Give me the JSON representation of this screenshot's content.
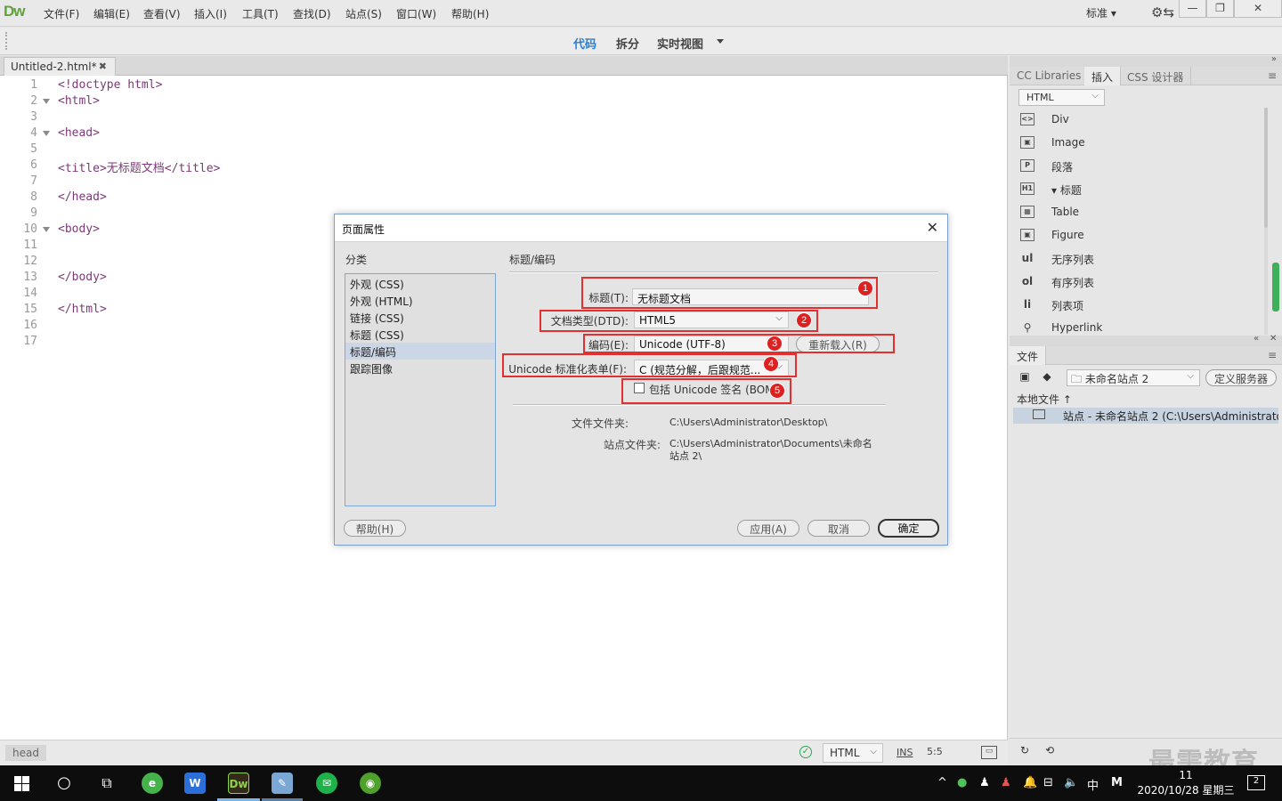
{
  "app": {
    "logo": "Dw",
    "menu": [
      "文件(F)",
      "编辑(E)",
      "查看(V)",
      "插入(I)",
      "工具(T)",
      "查找(D)",
      "站点(S)",
      "窗口(W)",
      "帮助(H)"
    ],
    "workspace": "标准",
    "window_buttons": [
      "—",
      "❐",
      "✕"
    ]
  },
  "toolbar": {
    "code": "代码",
    "split": "拆分",
    "live": "实时视图"
  },
  "doc_tab": {
    "name": "Untitled-2.html*",
    "close": "✖"
  },
  "editor": {
    "lines": [
      {
        "n": "1",
        "code": "<!doctype html>",
        "fold": false
      },
      {
        "n": "2",
        "code": "<html>",
        "fold": true
      },
      {
        "n": "3",
        "code": "",
        "fold": false
      },
      {
        "n": "4",
        "code": "<head>",
        "fold": true
      },
      {
        "n": "5",
        "code": "",
        "fold": false
      },
      {
        "n": "6",
        "code": "<title>无标题文档</title>",
        "fold": false
      },
      {
        "n": "7",
        "code": "",
        "fold": false
      },
      {
        "n": "8",
        "code": "</head>",
        "fold": false
      },
      {
        "n": "9",
        "code": "",
        "fold": false
      },
      {
        "n": "10",
        "code": "<body>",
        "fold": true
      },
      {
        "n": "11",
        "code": "",
        "fold": false
      },
      {
        "n": "12",
        "code": "",
        "fold": false
      },
      {
        "n": "13",
        "code": "</body>",
        "fold": false
      },
      {
        "n": "14",
        "code": "",
        "fold": false
      },
      {
        "n": "15",
        "code": "</html>",
        "fold": false
      },
      {
        "n": "16",
        "code": "",
        "fold": false
      },
      {
        "n": "17",
        "code": "",
        "fold": false
      }
    ]
  },
  "statusbar": {
    "tag": "head",
    "ok": "✓",
    "language": "HTML",
    "ins": "INS",
    "position": "5:5"
  },
  "right_panel": {
    "tabs": [
      "CC Libraries",
      "插入",
      "CSS 设计器"
    ],
    "active_tab": "插入",
    "insert_category": "HTML",
    "insert_items": [
      {
        "icon": "<>",
        "label": "Div"
      },
      {
        "icon": "▣",
        "label": "Image"
      },
      {
        "icon": "P",
        "label": "段落"
      },
      {
        "icon": "H1",
        "label": "▾ 标题"
      },
      {
        "icon": "▦",
        "label": "Table"
      },
      {
        "icon": "▣",
        "label": "Figure"
      },
      {
        "icon": "ul",
        "label": "无序列表"
      },
      {
        "icon": "ol",
        "label": "有序列表"
      },
      {
        "icon": "li",
        "label": "列表项"
      },
      {
        "icon": "⚲",
        "label": "Hyperlink"
      }
    ],
    "files_tab": "文件",
    "site_name": "未命名站点 2",
    "define_server": "定义服务器",
    "local_files": "本地文件 ↑",
    "site_row": "站点 - 未命名站点 2 (C:\\Users\\Administrator\\...",
    "watermark": "最需教育"
  },
  "dialog": {
    "title": "页面属性",
    "category_label": "分类",
    "categories": [
      "外观 (CSS)",
      "外观 (HTML)",
      "链接 (CSS)",
      "标题 (CSS)",
      "标题/编码",
      "跟踪图像"
    ],
    "selected_category": 4,
    "section_title": "标题/编码",
    "title_label": "标题(T):",
    "title_value": "无标题文档",
    "doctype_label": "文档类型(DTD):",
    "doctype_value": "HTML5",
    "encoding_label": "编码(E):",
    "encoding_value": "Unicode (UTF-8)",
    "reload_button": "重新载入(R)",
    "normalization_label": "Unicode 标准化表单(F):",
    "normalization_value": "C (规范分解，后跟规范...",
    "bom_label": "包括 Unicode 签名 (BOM)",
    "bom_checked": false,
    "folder_label": "文件文件夹:",
    "folder_value": "C:\\Users\\Administrator\\Desktop\\",
    "site_folder_label": "站点文件夹:",
    "site_folder_value": "C:\\Users\\Administrator\\Documents\\未命名站点 2\\",
    "help_button": "帮助(H)",
    "apply_button": "应用(A)",
    "cancel_button": "取消",
    "ok_button": "确定",
    "badges": [
      "1",
      "2",
      "3",
      "4",
      "5"
    ]
  },
  "taskbar": {
    "tray_ime": "中",
    "tray_m": "M",
    "clock_time": "11",
    "clock_date": "2020/10/28 星期三",
    "notifications": "2"
  },
  "colors": {
    "accent": "#2a7fd4",
    "annotation": "#e23030",
    "logo": "#5fa43a"
  }
}
